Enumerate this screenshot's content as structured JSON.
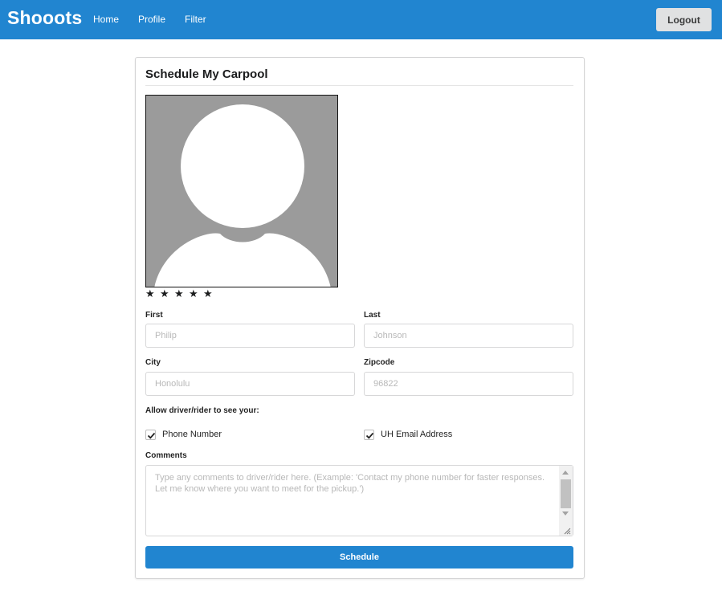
{
  "navbar": {
    "brand": "Shooots",
    "links": [
      "Home",
      "Profile",
      "Filter"
    ],
    "logout_label": "Logout",
    "color": "#2185d0"
  },
  "card": {
    "title": "Schedule My Carpool",
    "rating": {
      "stars": 5,
      "glyph": "★"
    },
    "first": {
      "label": "First",
      "placeholder": "Philip"
    },
    "last": {
      "label": "Last",
      "placeholder": "Johnson"
    },
    "city": {
      "label": "City",
      "placeholder": "Honolulu"
    },
    "zipcode": {
      "label": "Zipcode",
      "placeholder": "96822"
    },
    "allow_label": "Allow driver/rider to see your:",
    "phone": {
      "label": "Phone Number",
      "checked": true
    },
    "email": {
      "label": "UH Email Address",
      "checked": true
    },
    "comments": {
      "label": "Comments",
      "placeholder": "Type any comments to driver/rider here. (Example: 'Contact my phone number for faster responses. Let me know where you want to meet for the pickup.')"
    },
    "schedule_label": "Schedule",
    "accent_color": "#2185d0"
  },
  "icons": {
    "avatar": "user-silhouette-icon",
    "star": "star-icon",
    "checkbox_mark": "checkmark-icon"
  }
}
